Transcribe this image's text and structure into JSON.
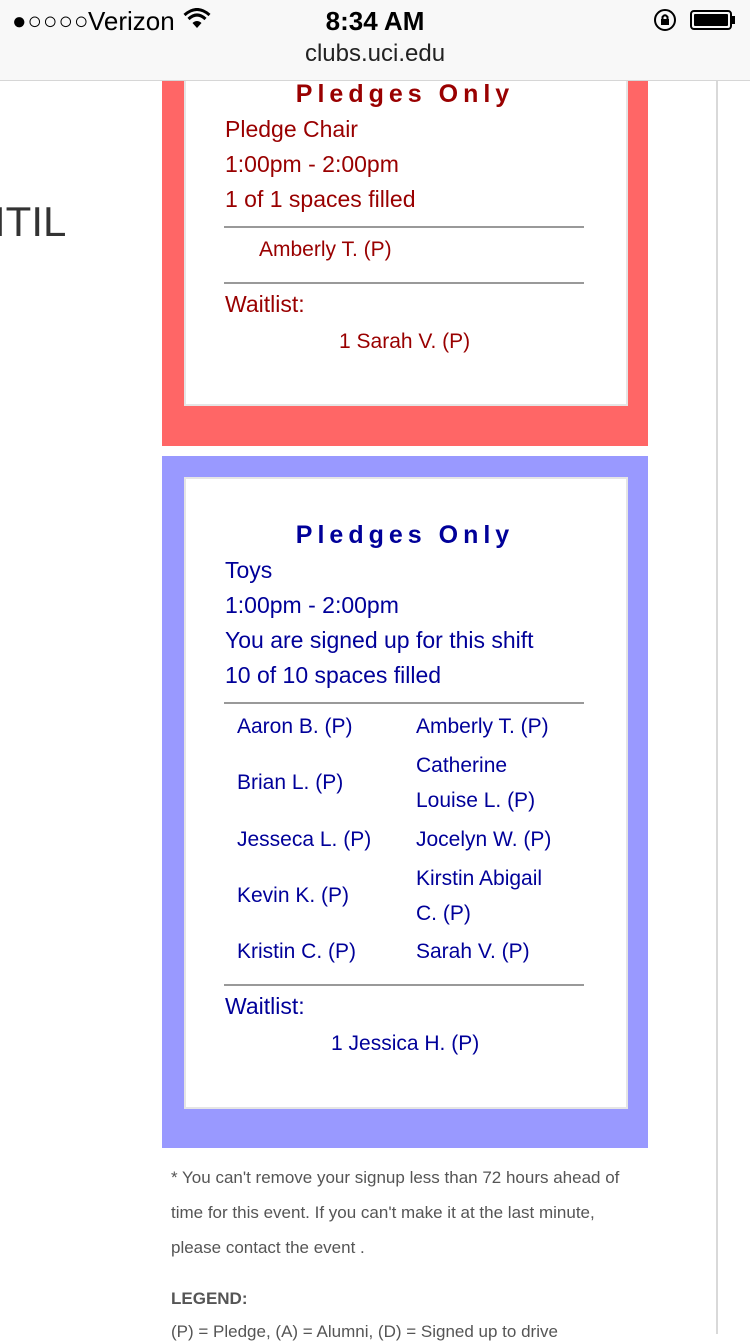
{
  "status_bar": {
    "signal": "●○○○○",
    "carrier": "Verizon",
    "time": "8:34 AM",
    "url": "clubs.uci.edu",
    "icons": [
      "wifi-icon",
      "rotation-lock-icon",
      "battery-icon"
    ]
  },
  "page": {
    "cut_text": "ITIL"
  },
  "shift_red": {
    "title": "Pledges Only",
    "role": "Pledge Chair",
    "time": "1:00pm - 2:00pm",
    "filled": "1 of 1 spaces filled",
    "members": [
      "Amberly T. (P)"
    ],
    "waitlist_label": "Waitlist:",
    "waitlist": [
      "1 Sarah V. (P)"
    ],
    "color": "#ff6666",
    "text_color": "#990000"
  },
  "shift_blue": {
    "title": "Pledges Only",
    "role": "Toys",
    "time": "1:00pm - 2:00pm",
    "signed_up": "You are signed up for this shift",
    "filled": "10 of 10 spaces filled",
    "members_left": [
      "Aaron B. (P)",
      "Brian L. (P)",
      "Jesseca L. (P)",
      "Kevin K. (P)",
      "Kristin C. (P)"
    ],
    "members_right": [
      [
        "Amberly T. (P)"
      ],
      [
        "Catherine",
        "Louise L. (P)"
      ],
      [
        "Jocelyn W. (P)"
      ],
      [
        "Kirstin Abigail",
        "C. (P)"
      ],
      [
        "Sarah V. (P)"
      ]
    ],
    "waitlist_label": "Waitlist:",
    "waitlist": [
      "1 Jessica H. (P)"
    ],
    "color": "#9999ff",
    "text_color": "#000099"
  },
  "footer": {
    "note_lines": [
      "* You can't remove your signup less than 72 hours ahead of",
      "time for this event. If you can't make it at the last minute,",
      "please contact the event ."
    ],
    "legend_title": "LEGEND:",
    "legend_text": "(P) = Pledge, (A) = Alumni, (D) = Signed up to drive"
  }
}
